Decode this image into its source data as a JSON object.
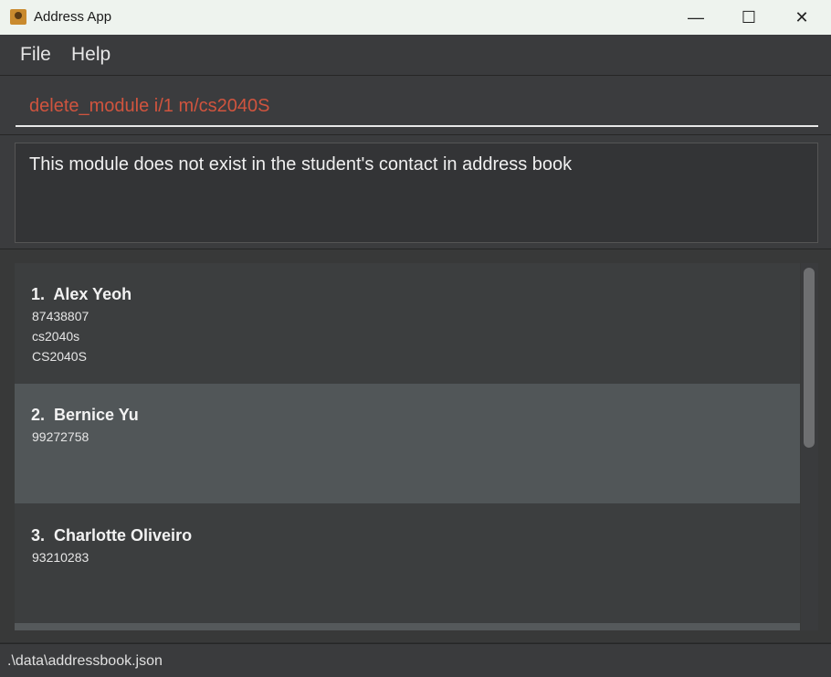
{
  "window": {
    "title": "Address App",
    "min_glyph": "—",
    "max_glyph": "☐",
    "close_glyph": "✕"
  },
  "menu": {
    "file": "File",
    "help": "Help"
  },
  "command": {
    "value": "delete_module i/1 m/cs2040S",
    "text_color": "#d0543e"
  },
  "result": {
    "message": "This module does not exist in the student's contact in address book"
  },
  "persons": [
    {
      "index": "1.",
      "name": "Alex Yeoh",
      "lines": [
        "87438807",
        "cs2040s",
        "CS2040S"
      ]
    },
    {
      "index": "2.",
      "name": "Bernice Yu",
      "lines": [
        "99272758"
      ]
    },
    {
      "index": "3.",
      "name": "Charlotte Oliveiro",
      "lines": [
        "93210283"
      ]
    }
  ],
  "selected_person_index": 1,
  "status": {
    "file_path": ".\\data\\addressbook.json"
  },
  "colors": {
    "background": "#2e2f30",
    "titlebar": "#eef3ee",
    "selected_card": "#515658"
  }
}
